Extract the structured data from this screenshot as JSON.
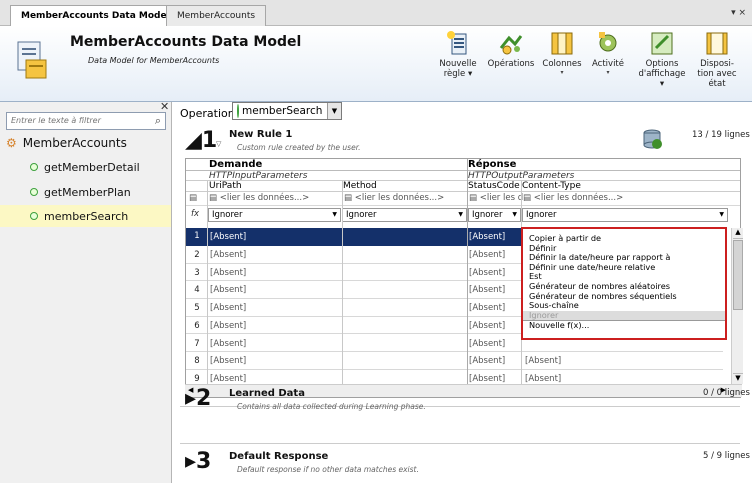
{
  "tabs": {
    "active": "MemberAccounts Data Model",
    "inactive": "MemberAccounts",
    "menu": "▾ ×"
  },
  "header": {
    "title": "MemberAccounts Data Model",
    "subtitle": "Data Model for MemberAccounts",
    "toolbar": [
      {
        "label1": "Nouvelle",
        "label2": "règle ▾"
      },
      {
        "label1": "Opérations",
        "label2": ""
      },
      {
        "label1": "Colonnes",
        "label2": "▾"
      },
      {
        "label1": "Activité",
        "label2": "▾"
      },
      {
        "label1": "Options",
        "label2": "d'affichage ▾"
      },
      {
        "label1": "Disposi-",
        "label2": "tion avec état"
      }
    ]
  },
  "sidebar": {
    "filter_placeholder": "Entrer le texte à filtrer",
    "root": "MemberAccounts",
    "items": [
      "getMemberDetail",
      "getMemberPlan",
      "memberSearch"
    ]
  },
  "operation": {
    "label": "Operation:",
    "value": "memberSearch"
  },
  "rules": [
    {
      "num": "1",
      "title": "New Rule 1",
      "subtitle": "Custom rule created by the user.",
      "count": "13 / 19 lignes"
    },
    {
      "num": "2",
      "title": "Learned Data",
      "subtitle": "Contains all data collected during Learning phase.",
      "count": "0 / 0 lignes"
    },
    {
      "num": "3",
      "title": "Default Response",
      "subtitle": "Default response if no other data matches exist.",
      "count": "5 / 9 lignes"
    }
  ],
  "grid": {
    "group_request": "Demande",
    "group_response": "Réponse",
    "sub_request": "HTTPInputParameters",
    "sub_response": "HTTPOutputParameters",
    "columns": [
      "UriPath",
      "Method",
      "StatusCode",
      "Content-Type"
    ],
    "link_placeholder": "<lier les données...>",
    "link_short": "<lier les d",
    "fx_label": "fx",
    "ignore": "Ignorer",
    "absent": "[Absent]",
    "rows": [
      "1",
      "2",
      "3",
      "4",
      "5",
      "6",
      "7",
      "8",
      "9"
    ]
  },
  "dropdown": {
    "options": [
      "Copier à partir de",
      "Définir",
      "Définir la date/heure par rapport à",
      "Définir une date/heure relative",
      "Est",
      "Générateur de nombres aléatoires",
      "Générateur de nombres séquentiels",
      "Sous-chaîne",
      "Ignorer",
      "Nouvelle f(x)..."
    ],
    "highlighted": "Ignorer"
  },
  "colors": {
    "accent": "#14306a",
    "highlight_border": "#cc1f1f",
    "tree_dot": "#3ea13e"
  }
}
